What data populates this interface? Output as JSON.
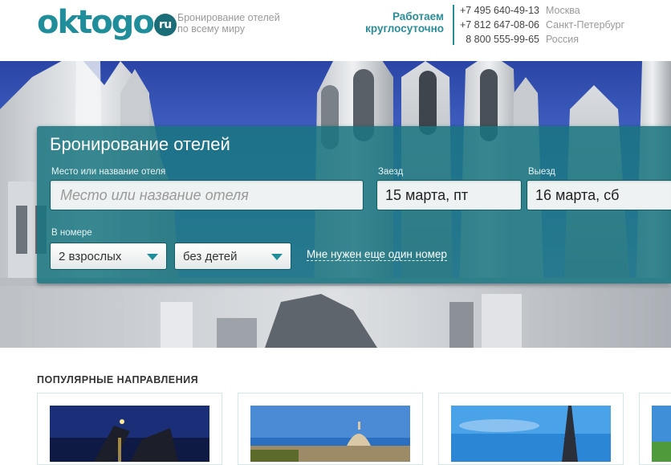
{
  "header": {
    "logo": {
      "text": "oktogo",
      "badge": "ru"
    },
    "tagline": [
      "Бронирование отелей",
      "по всему миру"
    ],
    "hours": [
      "Работаем",
      "круглосуточно"
    ],
    "phones": [
      {
        "number": "+7 495 640-49-13",
        "city": "Москва"
      },
      {
        "number": "+7 812 647-08-06",
        "city": "Санкт-Петербург"
      },
      {
        "number": "8 800 555-99-65",
        "city": "Россия"
      }
    ]
  },
  "search": {
    "title": "Бронирование отелей",
    "place_label": "Место или название отеля",
    "place_placeholder": "Место или название отеля",
    "checkin_label": "Заезд",
    "checkin_value": "15 марта, пт",
    "checkout_label": "Выезд",
    "checkout_value": "16 марта, сб",
    "room_label": "В номере",
    "adults_value": "2 взрослых",
    "children_value": "без детей",
    "add_room_link": "Мне нужен еще один номер"
  },
  "popular": {
    "title": "ПОПУЛЯРНЫЕ НАПРАВЛЕНИЯ"
  },
  "colors": {
    "brand": "#1f8e9a",
    "panel": "#187480",
    "sky": "#3a5fc4"
  }
}
